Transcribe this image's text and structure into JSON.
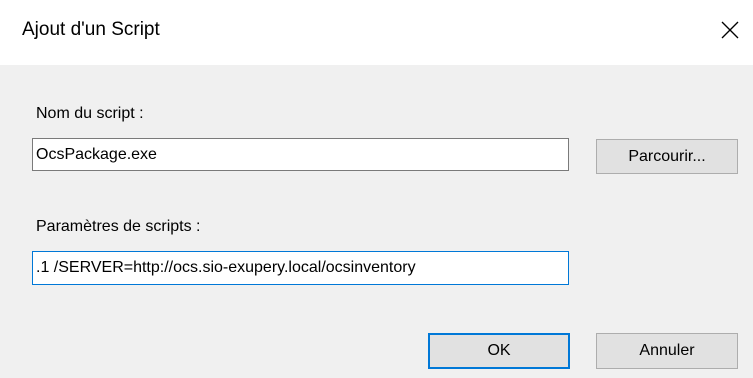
{
  "window": {
    "title": "Ajout d'un Script",
    "close_icon": "close-icon"
  },
  "form": {
    "script_name_label": "Nom du script :",
    "script_name_value": "OcsPackage.exe",
    "browse_label": "Parcourir...",
    "script_params_label": "Paramètres de scripts :",
    "script_params_value": ".1 /SERVER=http://ocs.sio-exupery.local/ocsinventory"
  },
  "buttons": {
    "ok_label": "OK",
    "cancel_label": "Annuler"
  },
  "colors": {
    "dialog_bg": "#f0f0f0",
    "titlebar_bg": "#ffffff",
    "focus_accent": "#0078d7",
    "button_bg": "#e1e1e1"
  }
}
